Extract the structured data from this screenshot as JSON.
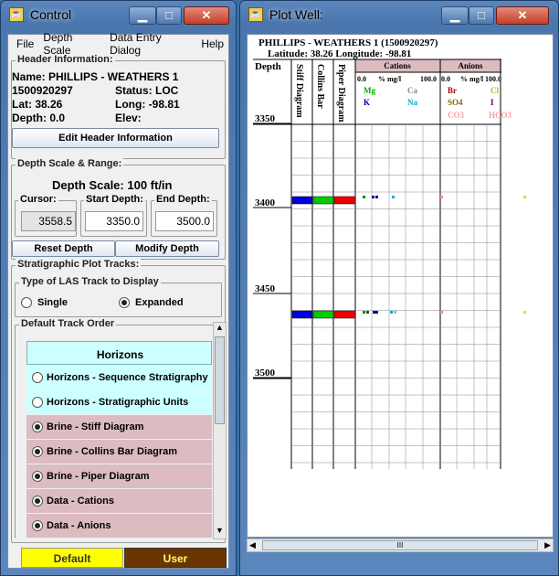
{
  "control": {
    "title": "Control",
    "menu": [
      "File",
      "Depth Scale",
      "Data Entry Dialog",
      "Help"
    ],
    "header_group": "Header Information:",
    "name": "Name: PHILLIPS - WEATHERS 1",
    "api": "1500920297",
    "status": "Status: LOC",
    "lat": "Lat: 38.26",
    "long": "Long: -98.81",
    "depth": "Depth: 0.0",
    "elev": "Elev:",
    "edit_header_btn": "Edit Header Information",
    "depth_group": "Depth Scale & Range:",
    "depth_scale": "Depth Scale: 100 ft/in",
    "cursor_label": "Cursor:",
    "cursor_value": "3558.5",
    "start_label": "Start Depth:",
    "start_value": "3350.0",
    "end_label": "End Depth:",
    "end_value": "3500.0",
    "reset_btn": "Reset Depth",
    "modify_btn": "Modify Depth",
    "strat_group": "Stratigraphic Plot Tracks:",
    "las_group": "Type of LAS Track to Display",
    "radio_single": "Single",
    "radio_expanded": "Expanded",
    "track_group": "Default Track Order",
    "track_items": [
      {
        "label": "Horizons"
      },
      {
        "label": "Horizons - Sequence Stratigraphy"
      },
      {
        "label": "Horizons - Stratigraphic Units"
      },
      {
        "label": "Brine - Stiff Diagram"
      },
      {
        "label": "Brine - Collins Bar Diagram"
      },
      {
        "label": "Brine - Piper Diagram"
      },
      {
        "label": "Data - Cations"
      },
      {
        "label": "Data - Anions"
      }
    ],
    "default_btn": "Default",
    "user_btn": "User"
  },
  "plot": {
    "title": "Plot Well:",
    "well": "PHILLIPS - WEATHERS 1 (1500920297)",
    "latlong": "Latitude: 38.26 Longitude: -98.81",
    "depth_header": "Depth",
    "col_stiff": "Stiff Diagram",
    "col_collins": "Collins Bar",
    "col_piper": "Piper Diagram",
    "cations": "Cations",
    "anions": "Anions",
    "scale_left": "0.0",
    "scale_unit": "% mg/l",
    "scale_right": "100.0",
    "cation_labels": [
      "Mg",
      "Ca",
      "K",
      "Na"
    ],
    "anion_labels": [
      "Br",
      "Cl",
      "SO4",
      "I",
      "CO3",
      "HCO3"
    ],
    "depth_ticks": [
      "3350",
      "3400",
      "3450",
      "3500"
    ],
    "colors": {
      "blue": "#0000dd",
      "green": "#00cc00",
      "red": "#ee0000",
      "yellow": "#ffff00",
      "brown": "#6b3500",
      "cyan": "#ccffff",
      "pink": "#dcbcc0"
    }
  },
  "scroll_glyph": "III"
}
